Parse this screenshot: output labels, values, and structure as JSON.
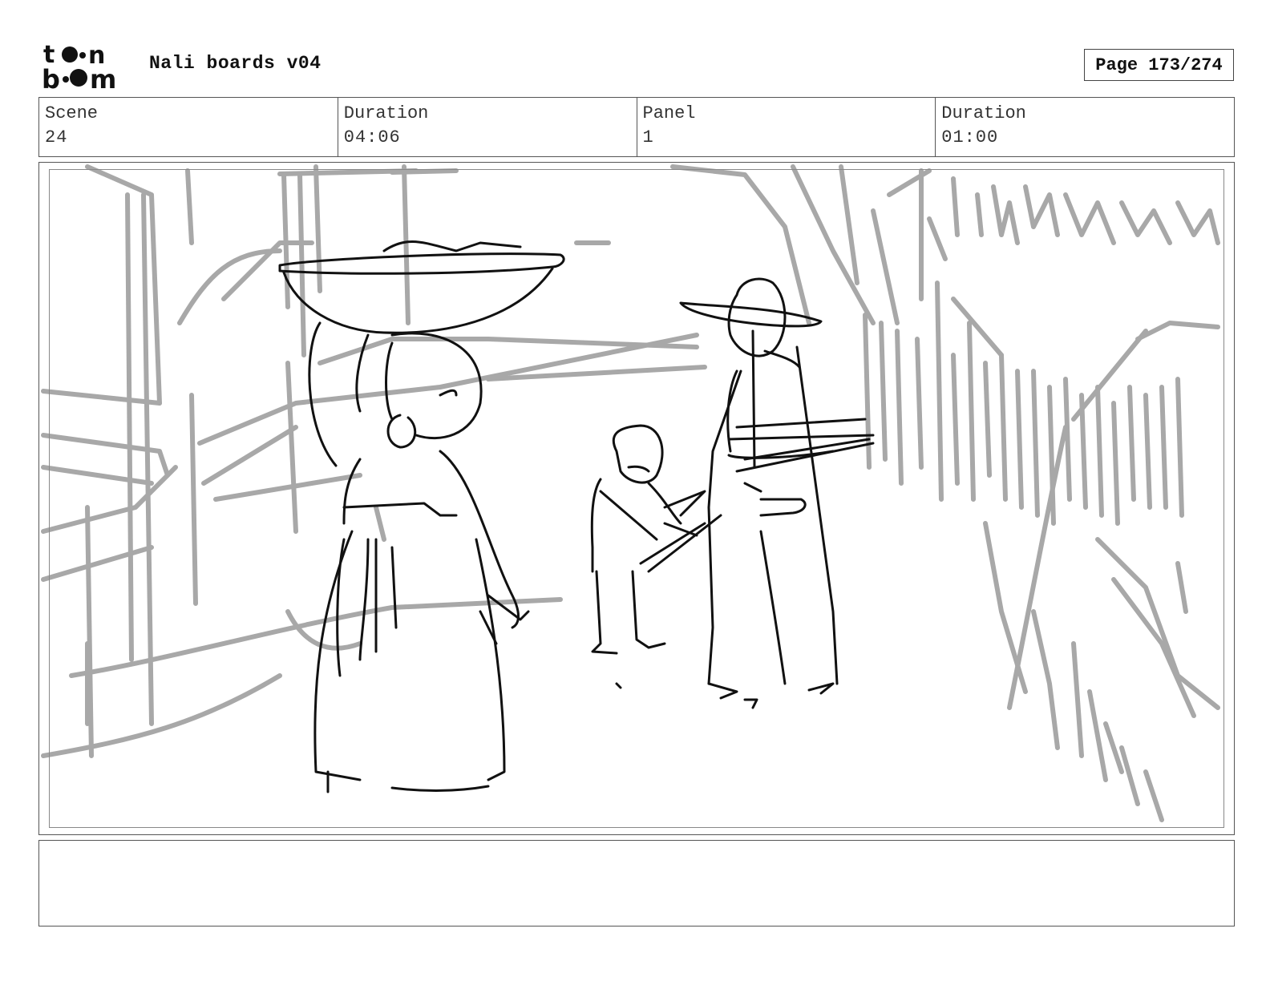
{
  "header": {
    "logo_text": "toonboom",
    "project_title": "Nali boards v04",
    "page_label": "Page 173/274"
  },
  "info": {
    "scene_label": "Scene",
    "scene_value": "24",
    "scene_duration_label": "Duration",
    "scene_duration_value": "04:06",
    "panel_label": "Panel",
    "panel_value": "1",
    "panel_duration_label": "Duration",
    "panel_duration_value": "01:00"
  },
  "notes": {
    "text": ""
  }
}
